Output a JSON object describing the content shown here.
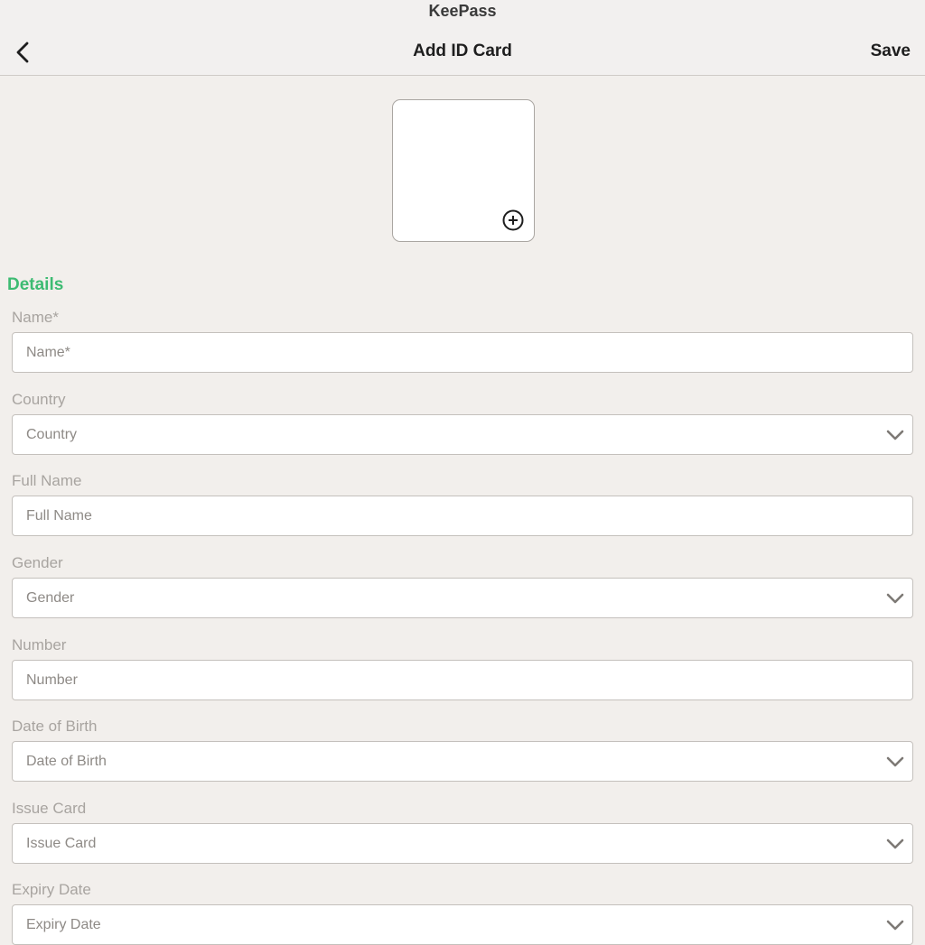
{
  "app": {
    "title": "KeePass"
  },
  "navbar": {
    "title": "Add ID Card",
    "save_label": "Save",
    "back_icon": "chevron-left-icon"
  },
  "photo": {
    "add_icon": "plus-circle-icon"
  },
  "details": {
    "section_title": "Details",
    "fields": {
      "name": {
        "label": "Name*",
        "placeholder": "Name*"
      },
      "country": {
        "label": "Country",
        "placeholder": "Country"
      },
      "full_name": {
        "label": "Full Name",
        "placeholder": "Full Name"
      },
      "gender": {
        "label": "Gender",
        "placeholder": "Gender"
      },
      "number": {
        "label": "Number",
        "placeholder": "Number"
      },
      "date_of_birth": {
        "label": "Date of Birth",
        "placeholder": "Date of Birth"
      },
      "issue_card": {
        "label": "Issue Card",
        "placeholder": "Issue Card"
      },
      "expiry_date": {
        "label": "Expiry Date",
        "placeholder": "Expiry Date"
      }
    }
  },
  "colors": {
    "background": "#f2efec",
    "accent": "#3dbb72",
    "label": "#a8a4a0",
    "field_border": "#c4c0bc"
  }
}
